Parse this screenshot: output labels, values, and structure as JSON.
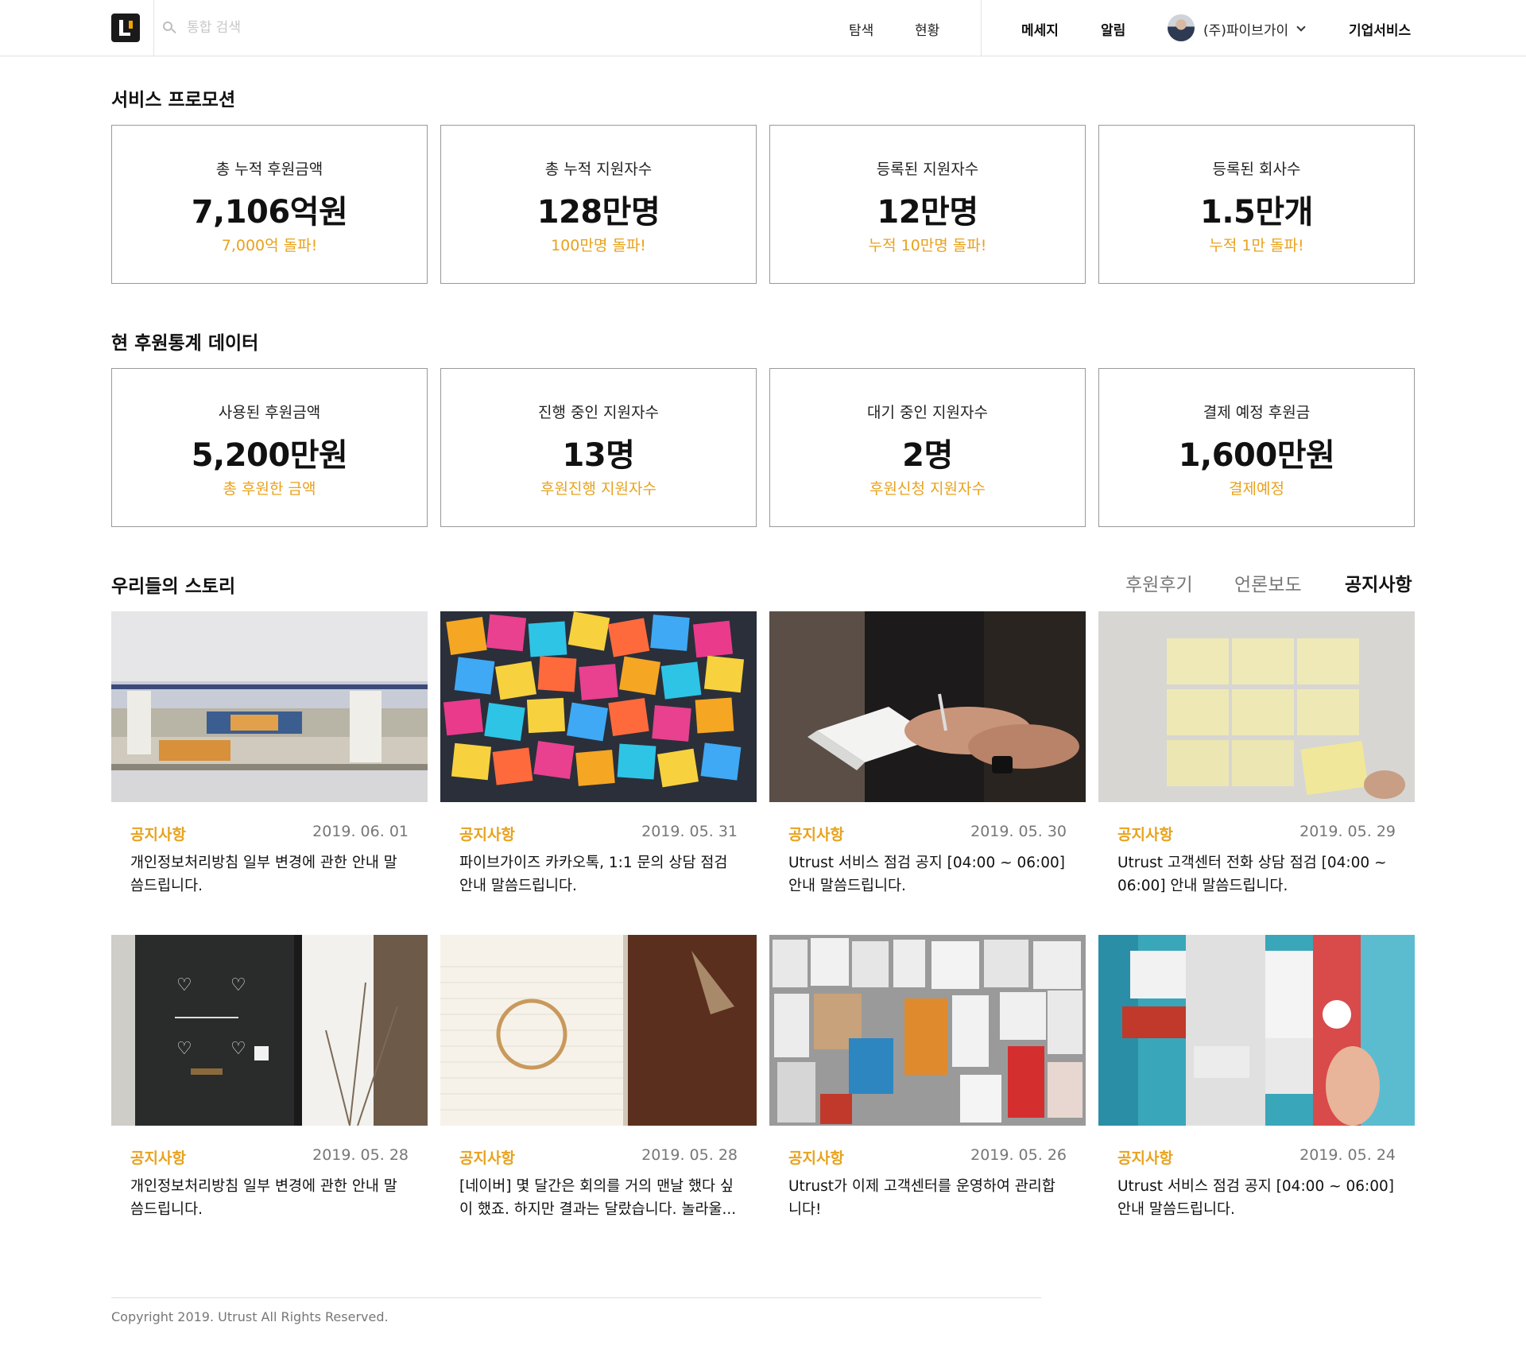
{
  "header": {
    "search_placeholder": "통합 검색",
    "nav": [
      "탐색",
      "현황"
    ],
    "messages": "메세지",
    "alerts": "알림",
    "account": "(주)파이브가이",
    "corporate": "기업서비스"
  },
  "promotion": {
    "title": "서비스 프로모션",
    "cards": [
      {
        "label": "총 누적 후원금액",
        "value": "7,106억원",
        "sub": "7,000억 돌파!"
      },
      {
        "label": "총 누적 지원자수",
        "value": "128만명",
        "sub": "100만명 돌파!"
      },
      {
        "label": "등록된 지원자수",
        "value": "12만명",
        "sub": "누적 10만명 돌파!"
      },
      {
        "label": "등록된 회사수",
        "value": "1.5만개",
        "sub": "누적 1만 돌파!"
      }
    ]
  },
  "stats": {
    "title": "현 후원통계 데이터",
    "cards": [
      {
        "label": "사용된 후원금액",
        "value": "5,200만원",
        "sub": "총 후원한 금액"
      },
      {
        "label": "진행 중인 지원자수",
        "value": "13명",
        "sub": "후원진행 지원자수"
      },
      {
        "label": "대기 중인 지원자수",
        "value": "2명",
        "sub": "후원신청 지원자수"
      },
      {
        "label": "결제 예정 후원금",
        "value": "1,600만원",
        "sub": "결제예정"
      }
    ]
  },
  "stories": {
    "title": "우리들의 스토리",
    "tabs": [
      "후원후기",
      "언론보도",
      "공지사항"
    ],
    "active_tab": "공지사항",
    "items": [
      {
        "category": "공지사항",
        "date": "2019. 06. 01",
        "text": "개인정보처리방침 일부 변경에 관한 안내 말씀드립니다.",
        "image": "newspapers"
      },
      {
        "category": "공지사항",
        "date": "2019. 05. 31",
        "text": "파이브가이즈 카카오톡, 1:1 문의 상담 점검 안내 말씀드립니다.",
        "image": "sticky-notes-wall"
      },
      {
        "category": "공지사항",
        "date": "2019. 05. 30",
        "text": "Utrust 서비스 점검 공지 [04:00 ~ 06:00] 안내 말씀드립니다.",
        "image": "person-writing"
      },
      {
        "category": "공지사항",
        "date": "2019. 05. 29",
        "text": "Utrust 고객센터 전화 상담 점검 [04:00 ~ 06:00] 안내 말씀드립니다.",
        "image": "yellow-notes-grid"
      },
      {
        "category": "공지사항",
        "date": "2019. 05. 28",
        "text": "개인정보처리방침 일부 변경에 관한 안내 말씀드립니다.",
        "image": "bonjour-door"
      },
      {
        "category": "공지사항",
        "date": "2019. 05. 28",
        "text": "[네이버] 몇 달간은 회의를 거의 맨날 했다 싶이 했죠. 하지만 결과는 달랐습니다. 놀라울...",
        "image": "notebook-coffee-ring"
      },
      {
        "category": "공지사항",
        "date": "2019. 05. 26",
        "text": "Utrust가 이제 고객센터를 운영하여 관리합니다!",
        "image": "poster-wall"
      },
      {
        "category": "공지사항",
        "date": "2019. 05. 24",
        "text": "Utrust 서비스 점검 공지 [04:00 ~ 06:00] 안내 말씀드립니다.",
        "image": "sticker-wall"
      }
    ]
  },
  "footer": {
    "copyright": "Copyright 2019. Utrust All Rights Reserved."
  },
  "colors": {
    "accent": "#e8a21c",
    "border": "#999999"
  }
}
